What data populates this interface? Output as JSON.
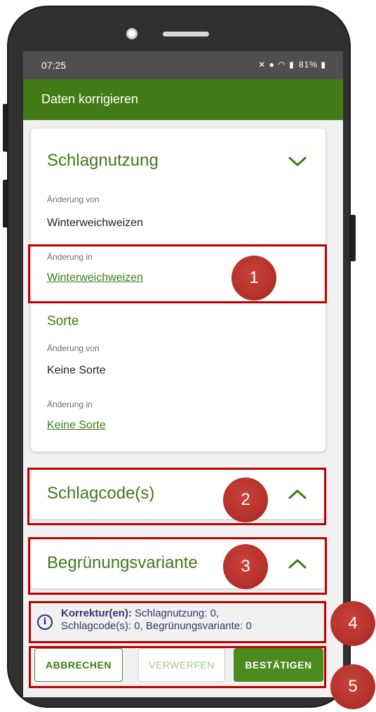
{
  "status_bar": {
    "time": "07:25",
    "icons": [
      "mute-icon",
      "location-icon",
      "wifi-icon",
      "signal-icon",
      "battery-icon"
    ],
    "battery_percent": "81%"
  },
  "app_bar": {
    "title": "Daten korrigieren",
    "color": "#437c16"
  },
  "schlagnutzung": {
    "title": "Schlagnutzung",
    "expanded": true,
    "change_from_label": "Änderung von",
    "change_from_value": "Winterweichweizen",
    "change_to_label": "Änderung in",
    "change_to_value": "Winterweichweizen",
    "sorte": {
      "title": "Sorte",
      "change_from_label": "Änderung von",
      "change_from_value": "Keine Sorte",
      "change_to_label": "Änderung in",
      "change_to_value": "Keine Sorte"
    }
  },
  "schlagcodes": {
    "title": "Schlagcode(s)",
    "expanded": false
  },
  "begruenung": {
    "title": "Begrünungsvariante",
    "expanded": false
  },
  "info": {
    "label": "Korrektur(en):",
    "line1": " Schlagnutzung: 0,",
    "line2": "Schlagcode(s): 0,  Begrünungsvariante: 0"
  },
  "actions": {
    "cancel": "ABBRECHEN",
    "discard": "VERWERFEN",
    "confirm": "BESTÄTIGEN"
  },
  "annotations": {
    "markers": [
      "1",
      "2",
      "3",
      "4",
      "5"
    ],
    "highlight_color": "#c00000"
  }
}
